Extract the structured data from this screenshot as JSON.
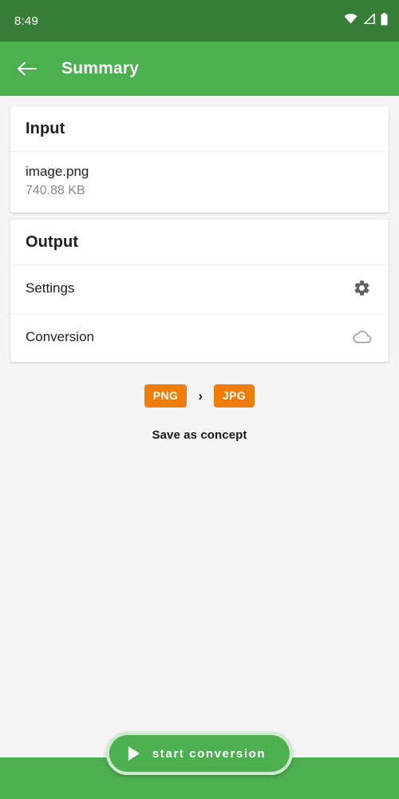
{
  "status_bar": {
    "time": "8:49",
    "icons": [
      "wifi-icon",
      "cellular-signal-icon",
      "battery-icon"
    ],
    "background_color": "#377d38"
  },
  "app_bar": {
    "back_icon": "back-arrow-icon",
    "title": "Summary",
    "background_color": "#4caf50"
  },
  "cards": {
    "input": {
      "header": "Input",
      "file_name": "image.png",
      "file_size": "740.88 KB"
    },
    "output": {
      "header": "Output",
      "rows": [
        {
          "label": "Settings",
          "icon": "gear-icon",
          "icon_color": "#616161"
        },
        {
          "label": "Conversion",
          "icon": "cloud-icon",
          "icon_color": "#a0a0a0"
        }
      ]
    }
  },
  "format_conversion": {
    "source_format": "PNG",
    "arrow": "›",
    "target_format": "JPG",
    "badge_color": "#f07c0a"
  },
  "save_concept": {
    "label": "Save as concept"
  },
  "start_button": {
    "label": "start conversion",
    "icon": "play-icon",
    "background_color": "#4caf50"
  },
  "bottom_bar": {
    "background_color": "#4caf50"
  }
}
